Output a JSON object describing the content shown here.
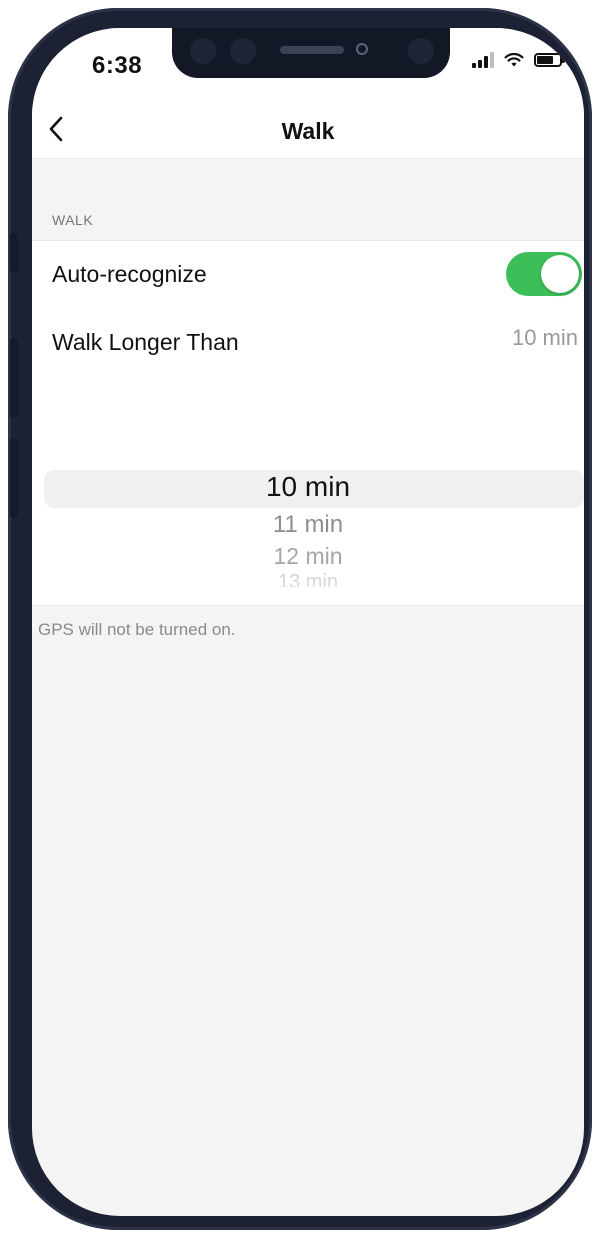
{
  "status_bar": {
    "time": "6:38"
  },
  "nav": {
    "title": "Walk",
    "back_icon": "chevron-left-icon"
  },
  "section": {
    "header": "WALK"
  },
  "settings": {
    "auto_recognize": {
      "label": "Auto-recognize",
      "enabled": true
    },
    "walk_longer_than": {
      "label": "Walk Longer Than",
      "value": "10 min"
    }
  },
  "picker": {
    "selected": "10 min",
    "options": [
      "11 min",
      "12 min",
      "13 min"
    ]
  },
  "footnote": "GPS will not be turned on.",
  "colors": {
    "toggle_on": "#3cbf58",
    "background": "#f4f4f4",
    "bezel": "#1c2233"
  }
}
